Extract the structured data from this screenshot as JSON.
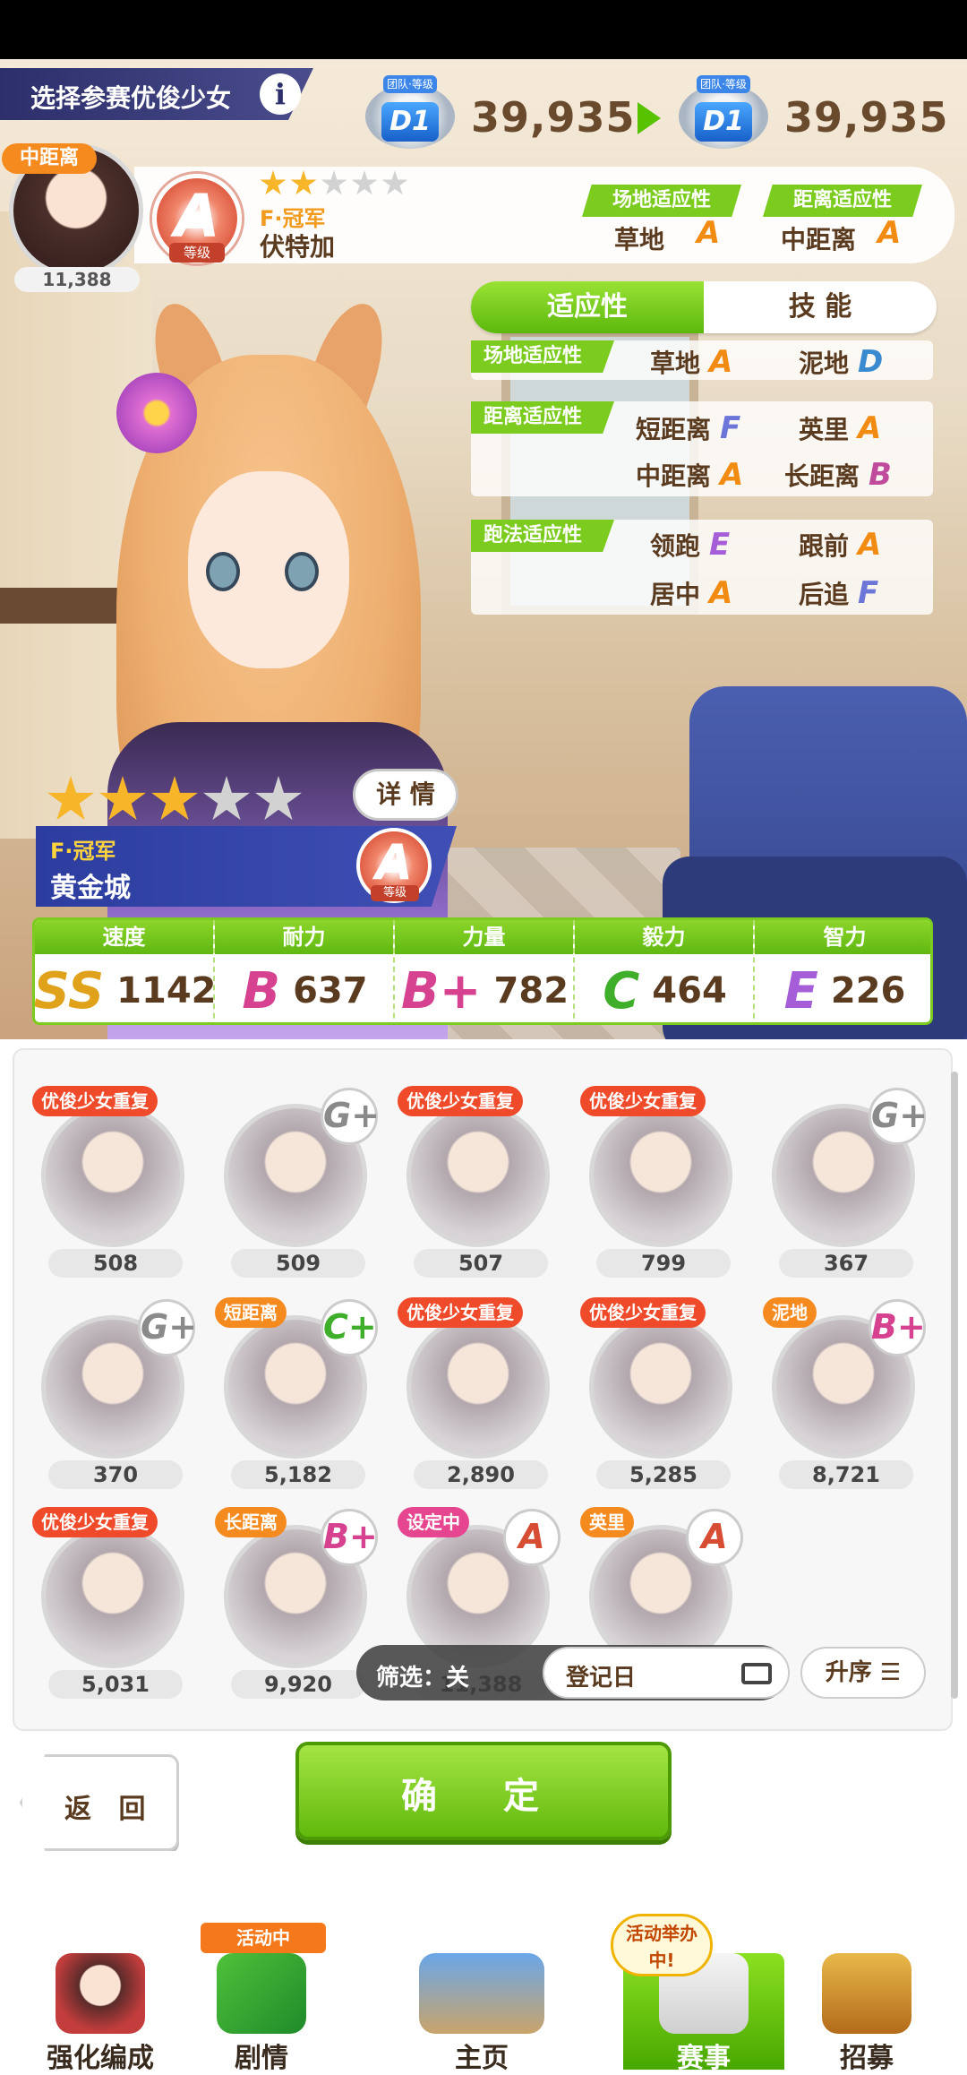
{
  "header": {
    "title": "选择参赛优俊少女",
    "info_icon": "i",
    "rank_label": "团队·等级",
    "rank_from": "D1",
    "score_from": "39,935",
    "rank_to": "D1",
    "score_to": "39,935"
  },
  "selected": {
    "distance_tag": "中距离",
    "avatar_fans": "11,388",
    "grade": "A",
    "grade_sub": "等级",
    "stars_filled": 2,
    "stars_total": 5,
    "title": "F·冠军",
    "name": "伏特加",
    "track_apt_label": "场地适应性",
    "track_apt_value": "草地",
    "track_apt_grade": "A",
    "dist_apt_label": "距离适应性",
    "dist_apt_value": "中距离",
    "dist_apt_grade": "A"
  },
  "tabs": [
    "适应性",
    "技 能"
  ],
  "aptitude": {
    "track": {
      "label": "场地适应性",
      "items": [
        {
          "name": "草地",
          "grade": "A"
        },
        {
          "name": "泥地",
          "grade": "D"
        }
      ]
    },
    "distance": {
      "label": "距离适应性",
      "items": [
        {
          "name": "短距离",
          "grade": "F"
        },
        {
          "name": "英里",
          "grade": "A"
        },
        {
          "name": "中距离",
          "grade": "A"
        },
        {
          "name": "长距离",
          "grade": "B"
        }
      ]
    },
    "style": {
      "label": "跑法适应性",
      "items": [
        {
          "name": "领跑",
          "grade": "E"
        },
        {
          "name": "跟前",
          "grade": "A"
        },
        {
          "name": "居中",
          "grade": "A"
        },
        {
          "name": "后追",
          "grade": "F"
        }
      ]
    }
  },
  "character": {
    "stars_filled": 3,
    "stars_total": 5,
    "details_label": "详 情",
    "title": "F·冠军",
    "name": "黄金城",
    "grade": "A",
    "grade_sub": "等级"
  },
  "stats": [
    {
      "label": "速度",
      "rank": "SS",
      "value": "1142",
      "color": "#e0a21a"
    },
    {
      "label": "耐力",
      "rank": "B",
      "value": "637",
      "color": "#d6428f"
    },
    {
      "label": "力量",
      "rank": "B+",
      "value": "782",
      "color": "#d6428f"
    },
    {
      "label": "毅力",
      "rank": "C",
      "value": "464",
      "color": "#3fae2a"
    },
    {
      "label": "智力",
      "rank": "E",
      "value": "226",
      "color": "#a55ed8"
    }
  ],
  "roster": [
    {
      "tag": "优俊少女重复",
      "tag_color": "red",
      "badge": "",
      "fans": "508"
    },
    {
      "tag": "",
      "tag_color": "",
      "badge": "G+",
      "fans": "509"
    },
    {
      "tag": "优俊少女重复",
      "tag_color": "red",
      "badge": "",
      "fans": "507"
    },
    {
      "tag": "优俊少女重复",
      "tag_color": "red",
      "badge": "",
      "fans": "799"
    },
    {
      "tag": "",
      "tag_color": "",
      "badge": "G+",
      "fans": "367"
    },
    {
      "tag": "",
      "tag_color": "",
      "badge": "G+",
      "fans": "370"
    },
    {
      "tag": "短距离",
      "tag_color": "orange",
      "badge": "C+",
      "fans": "5,182"
    },
    {
      "tag": "优俊少女重复",
      "tag_color": "red",
      "badge": "",
      "fans": "2,890"
    },
    {
      "tag": "优俊少女重复",
      "tag_color": "red",
      "badge": "",
      "fans": "5,285"
    },
    {
      "tag": "泥地",
      "tag_color": "orange",
      "badge": "B+",
      "fans": "8,721"
    },
    {
      "tag": "优俊少女重复",
      "tag_color": "red",
      "badge": "",
      "fans": "5,031"
    },
    {
      "tag": "长距离",
      "tag_color": "orange",
      "badge": "B+",
      "fans": "9,920"
    },
    {
      "tag": "设定中",
      "tag_color": "pink",
      "badge": "A",
      "fans": "11,388"
    },
    {
      "tag": "英里",
      "tag_color": "orange",
      "badge": "A",
      "fans": ""
    }
  ],
  "filter": {
    "label": "筛选：关",
    "sort_field": "登记日",
    "order_label": "升序"
  },
  "buttons": {
    "back": "返 回",
    "confirm": "确 定"
  },
  "nav": {
    "items": [
      "强化编成",
      "剧情",
      "主页",
      "赛事",
      "招募"
    ],
    "story_badge": "活动中",
    "race_badge": "活动举办中!",
    "active": "赛事"
  }
}
